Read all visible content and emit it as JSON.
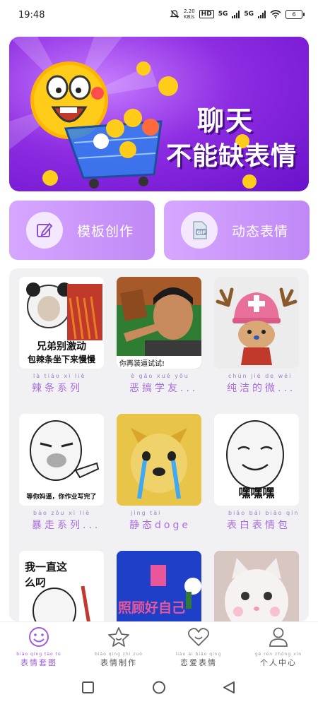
{
  "status_bar": {
    "time": "19:48",
    "net_speed_value": "2.20",
    "net_speed_unit": "KB/s",
    "hd_label": "HD",
    "signal1": "5G",
    "signal2": "5G",
    "battery": "6"
  },
  "banner": {
    "line1": "聊天",
    "line2": "不能缺表情"
  },
  "actions": [
    {
      "label": "模板创作",
      "icon": "edit-icon"
    },
    {
      "label": "动态表情",
      "icon": "gif-icon"
    }
  ],
  "grid": [
    {
      "pinyin": "là tiáo xì liè",
      "caption": "辣条系列",
      "thumb_text1": "兄弟别激动",
      "thumb_text2": "包辣条坐下来慢慢"
    },
    {
      "pinyin": "è gǎo xué yǒu",
      "caption": "恶搞学友...",
      "thumb_text1": "你再装逼试试!",
      "thumb_text2": ""
    },
    {
      "pinyin": "chún jié de wēi",
      "caption": "纯洁的微...",
      "thumb_text1": "",
      "thumb_text2": ""
    },
    {
      "pinyin": "bào zǒu xì liè",
      "caption": "暴走系列...",
      "thumb_text1": "等你妈逼，你作业写完了",
      "thumb_text2": ""
    },
    {
      "pinyin": "jìng tài",
      "caption": "静态doge",
      "thumb_text1": "",
      "thumb_text2": ""
    },
    {
      "pinyin": "biǎo bái biǎo qíng bāo",
      "caption": "表白表情包",
      "thumb_text1": "嘿嘿嘿",
      "thumb_text2": ""
    },
    {
      "pinyin": "",
      "caption": "",
      "thumb_text1": "我一直这",
      "thumb_text2": "么叼"
    },
    {
      "pinyin": "",
      "caption": "",
      "thumb_text1": "照顾好自己",
      "thumb_text2": ""
    },
    {
      "pinyin": "",
      "caption": "",
      "thumb_text1": "",
      "thumb_text2": ""
    }
  ],
  "bottom_nav": [
    {
      "pinyin": "biǎo qíng tào tú",
      "label": "表情套图",
      "icon": "smile-icon",
      "active": true
    },
    {
      "pinyin": "biǎo qíng zhì zuò",
      "label": "表情制作",
      "icon": "star-icon",
      "active": false
    },
    {
      "pinyin": "liàn ài biǎo qíng",
      "label": "恋爱表情",
      "icon": "heart-icon",
      "active": false
    },
    {
      "pinyin": "gè rén zhōng xīn",
      "label": "个人中心",
      "icon": "person-icon",
      "active": false
    }
  ],
  "colors": {
    "accent": "#a05ce0",
    "card": "#c088f6",
    "banner": "#8e2de2"
  }
}
